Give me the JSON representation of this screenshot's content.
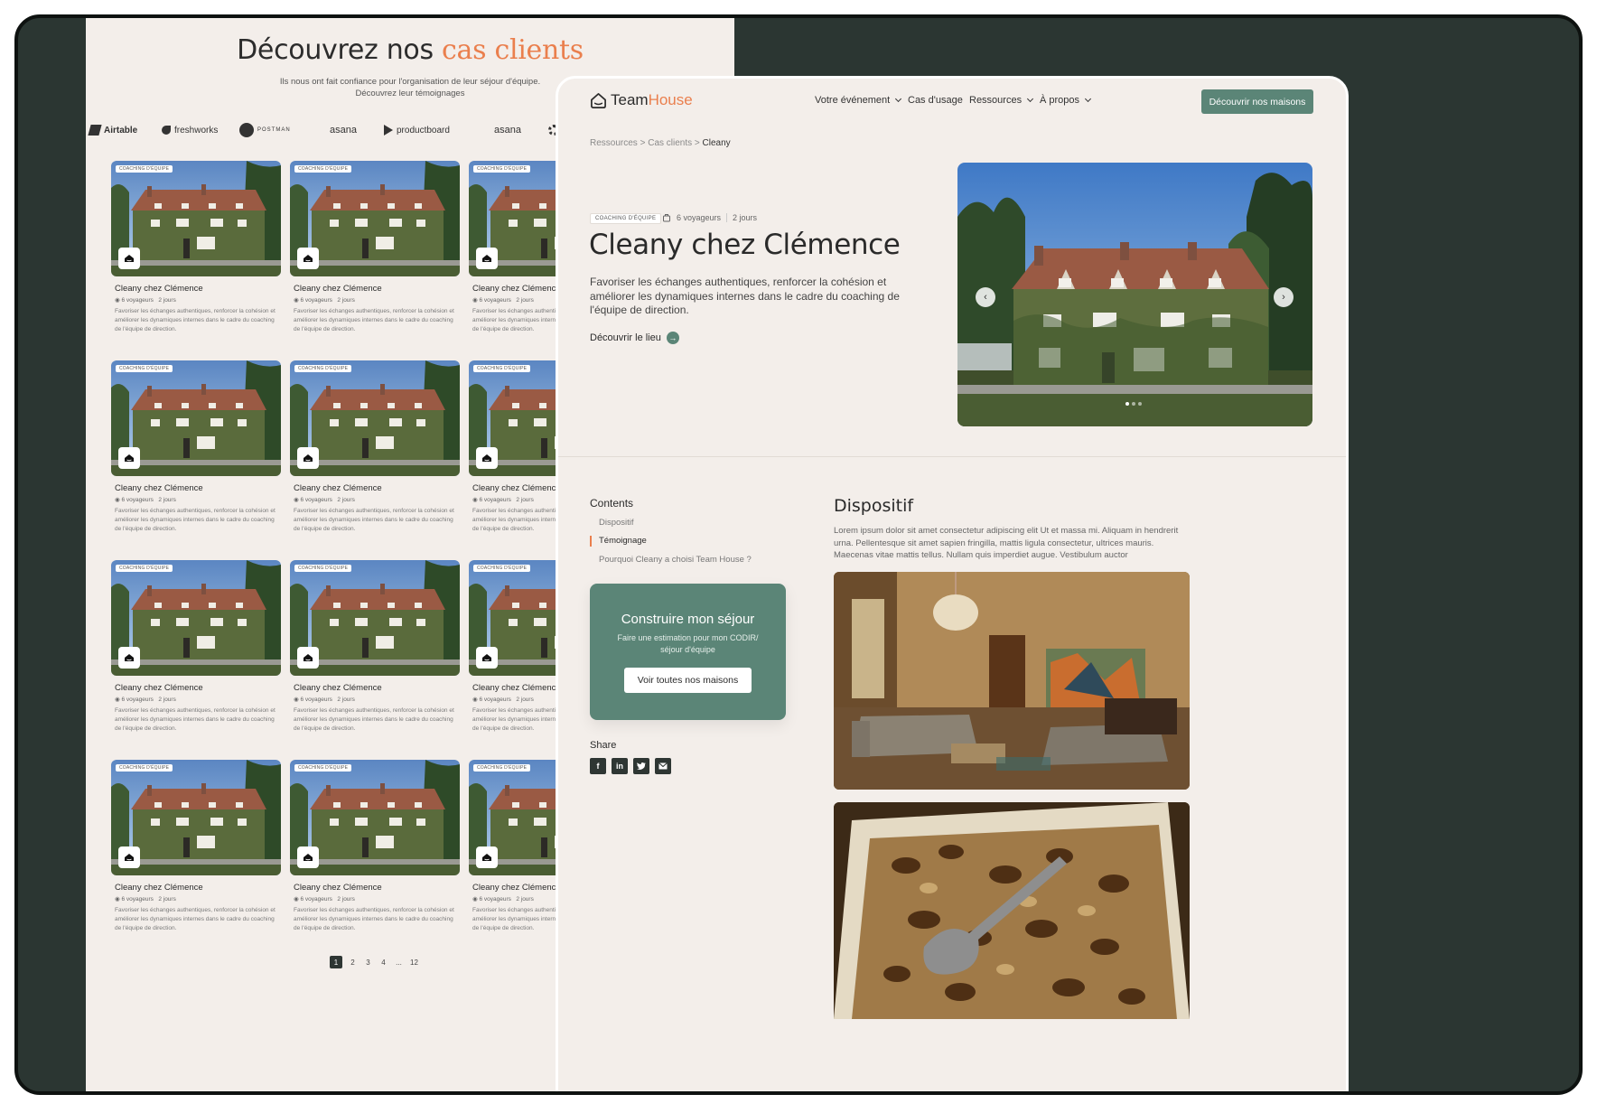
{
  "listing": {
    "title_main": "Découvrez nos ",
    "title_accent": "cas clients",
    "subtitle_line1": "Ils nous ont fait confiance pour l'organisation de leur séjour d'équipe.",
    "subtitle_line2": "Découvrez leur témoignages",
    "logos": [
      {
        "name": "Airtable",
        "icon": "airtable-icon"
      },
      {
        "name": "freshworks",
        "icon": "freshworks-icon"
      },
      {
        "name": "POSTMAN",
        "icon": "postman-icon"
      },
      {
        "name": "asana",
        "icon": "asana-icon"
      },
      {
        "name": "productboard",
        "icon": "productboard-icon"
      },
      {
        "name": "asana",
        "icon": "asana-icon"
      },
      {
        "name": "G",
        "icon": "gear-icon"
      }
    ],
    "card": {
      "tag": "COACHING D'ÉQUIPE",
      "title": "Cleany chez Clémence",
      "travelers": "6 voyageurs",
      "days": "2 jours",
      "description": "Favoriser les échanges authentiques, renforcer la cohésion et améliorer les dynamiques internes dans le cadre du coaching de l'équipe de direction."
    },
    "pagination": [
      "1",
      "2",
      "3",
      "4",
      "...",
      "12"
    ],
    "pagination_active": "1"
  },
  "detail": {
    "brand_main": "Team",
    "brand_accent": "House",
    "nav": [
      {
        "label": "Votre événement",
        "dropdown": true
      },
      {
        "label": "Cas d'usage",
        "dropdown": false
      },
      {
        "label": "Ressources",
        "dropdown": true
      },
      {
        "label": "À propos",
        "dropdown": true
      }
    ],
    "cta": "Découvrir nos maisons",
    "breadcrumb": {
      "a": "Ressources",
      "b": "Cas clients",
      "current": "Cleany",
      "sep": ">"
    },
    "hero": {
      "tag": "COACHING D'ÉQUIPE",
      "travelers": "6 voyageurs",
      "days": "2 jours",
      "title": "Cleany chez Clémence",
      "description": "Favoriser les échanges authentiques, renforcer la cohésion et améliorer les dynamiques internes dans le cadre du coaching de l'équipe de direction.",
      "link": "Découvrir le lieu",
      "carousel_count": 3,
      "carousel_active": 1
    },
    "toc": {
      "heading": "Contents",
      "items": [
        "Dispositif",
        "Témoignage",
        "Pourquoi Cleany a choisi Team House ?"
      ],
      "active": "Témoignage"
    },
    "promo": {
      "title": "Construire mon séjour",
      "subtitle": "Faire une estimation pour mon CODIR/ séjour d'équipe",
      "button": "Voir toutes nos maisons"
    },
    "share": {
      "heading": "Share",
      "icons": [
        "facebook-icon",
        "linkedin-icon",
        "twitter-icon",
        "mail-icon"
      ]
    },
    "section": {
      "title": "Dispositif",
      "text": "Lorem ipsum dolor sit amet consectetur adipiscing elit Ut et massa mi. Aliquam in hendrerit urna. Pellentesque sit amet sapien fringilla, mattis ligula consectetur, ultrices mauris. Maecenas vitae mattis tellus. Nullam quis imperdiet augue. Vestibulum auctor"
    }
  }
}
